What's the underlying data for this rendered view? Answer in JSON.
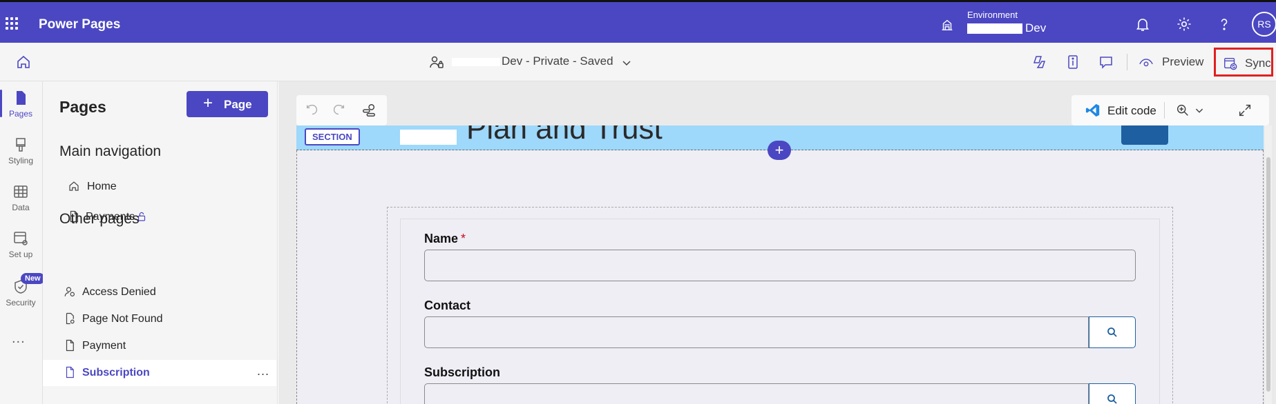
{
  "topbar": {
    "app_name": "Power Pages",
    "environment_label": "Environment",
    "environment_name": "Dev",
    "avatar_initials": "RS"
  },
  "subbar": {
    "site_title": "Dev - Private - Saved",
    "preview_label": "Preview",
    "sync_label": "Sync"
  },
  "rail": {
    "items": [
      {
        "label": "Pages"
      },
      {
        "label": "Styling"
      },
      {
        "label": "Data"
      },
      {
        "label": "Set up"
      },
      {
        "label": "Security"
      }
    ],
    "new_badge": "New",
    "more": "..."
  },
  "pages_panel": {
    "title": "Pages",
    "add_button": "Page",
    "main_nav_title": "Main navigation",
    "main_nav": [
      {
        "label": "Home"
      },
      {
        "label": "Payments"
      }
    ],
    "other_pages_title": "Other pages",
    "other_pages": [
      {
        "label": "Access Denied"
      },
      {
        "label": "Page Not Found"
      },
      {
        "label": "Payment"
      },
      {
        "label": "Subscription"
      }
    ],
    "row_more": "..."
  },
  "canvas": {
    "edit_code_label": "Edit code",
    "hero_title": "Plan and Trust",
    "section_tag": "SECTION",
    "add_section": "+",
    "form": {
      "fields": [
        {
          "label": "Name",
          "required_mark": "*"
        },
        {
          "label": "Contact"
        },
        {
          "label": "Subscription"
        }
      ]
    }
  },
  "colors": {
    "brand": "#4b47c2",
    "hero_bg": "#9ed8fb",
    "highlight": "#e02020"
  }
}
